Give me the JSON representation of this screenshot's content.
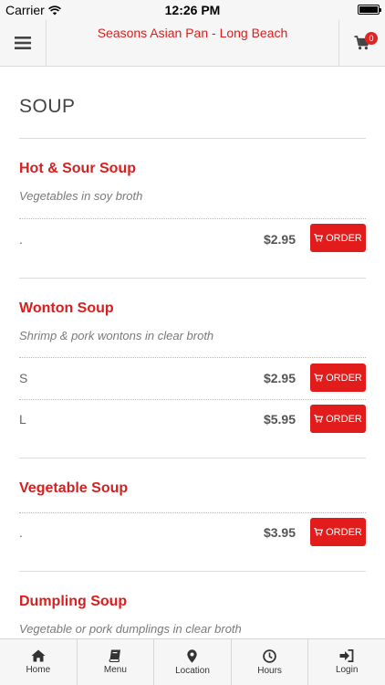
{
  "status_bar": {
    "carrier": "Carrier",
    "time": "12:26 PM"
  },
  "nav": {
    "title": "Seasons Asian Pan - Long Beach",
    "cart_count": "0"
  },
  "section": {
    "title": "SOUP"
  },
  "items": [
    {
      "name": "Hot & Sour Soup",
      "description": "Vegetables in soy broth",
      "options": [
        {
          "label": ".",
          "price": "$2.95",
          "order_label": "ORDER"
        }
      ]
    },
    {
      "name": "Wonton Soup",
      "description": "Shrimp & pork wontons in clear broth",
      "options": [
        {
          "label": "S",
          "price": "$2.95",
          "order_label": "ORDER"
        },
        {
          "label": "L",
          "price": "$5.95",
          "order_label": "ORDER"
        }
      ]
    },
    {
      "name": "Vegetable Soup",
      "description": "",
      "options": [
        {
          "label": ".",
          "price": "$3.95",
          "order_label": "ORDER"
        }
      ]
    },
    {
      "name": "Dumpling Soup",
      "description": "Vegetable or pork dumplings in clear broth",
      "options": []
    }
  ],
  "tabs": [
    {
      "label": "Home",
      "icon": "home-icon"
    },
    {
      "label": "Menu",
      "icon": "book-icon"
    },
    {
      "label": "Location",
      "icon": "map-pin-icon"
    },
    {
      "label": "Hours",
      "icon": "clock-icon"
    },
    {
      "label": "Login",
      "icon": "sign-in-icon"
    }
  ],
  "colors": {
    "accent": "#d81e1e",
    "button": "#e21b1b",
    "bar_bg": "#f6f6f6"
  }
}
